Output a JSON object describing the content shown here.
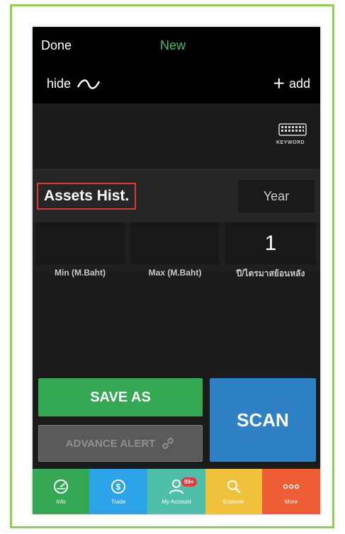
{
  "header": {
    "done_label": "Done",
    "new_label": "New",
    "hide_label": "hide",
    "add_label": "add"
  },
  "keyboard": {
    "label": "KEYWORD"
  },
  "criteria": {
    "title": "Assets Hist.",
    "period_select": "Year",
    "min_value": "",
    "max_value": "",
    "years_value": "1",
    "min_label": "Min (M.Baht)",
    "max_label": "Max (M.Baht)",
    "years_label": "ปี/ไตรมาสย้อนหลัง"
  },
  "actions": {
    "save_as_label": "SAVE AS",
    "advance_alert_label": "ADVANCE ALERT",
    "scan_label": "SCAN"
  },
  "tabs": [
    {
      "label": "Info",
      "icon": "gauge-icon"
    },
    {
      "label": "Trade",
      "icon": "dollar-icon"
    },
    {
      "label": "My Account",
      "icon": "user-icon",
      "badge": "99+"
    },
    {
      "label": "Explorer",
      "icon": "search-icon"
    },
    {
      "label": "More",
      "icon": "more-icon"
    }
  ],
  "colors": {
    "green": "#35a853",
    "blue": "#2f81c6",
    "tab_blue": "#2aa3e8",
    "teal": "#4ebfa9",
    "yellow": "#f0c23b",
    "orange": "#ee5d34",
    "highlight_red": "#d83a34",
    "frame_green": "#8fd14f"
  }
}
